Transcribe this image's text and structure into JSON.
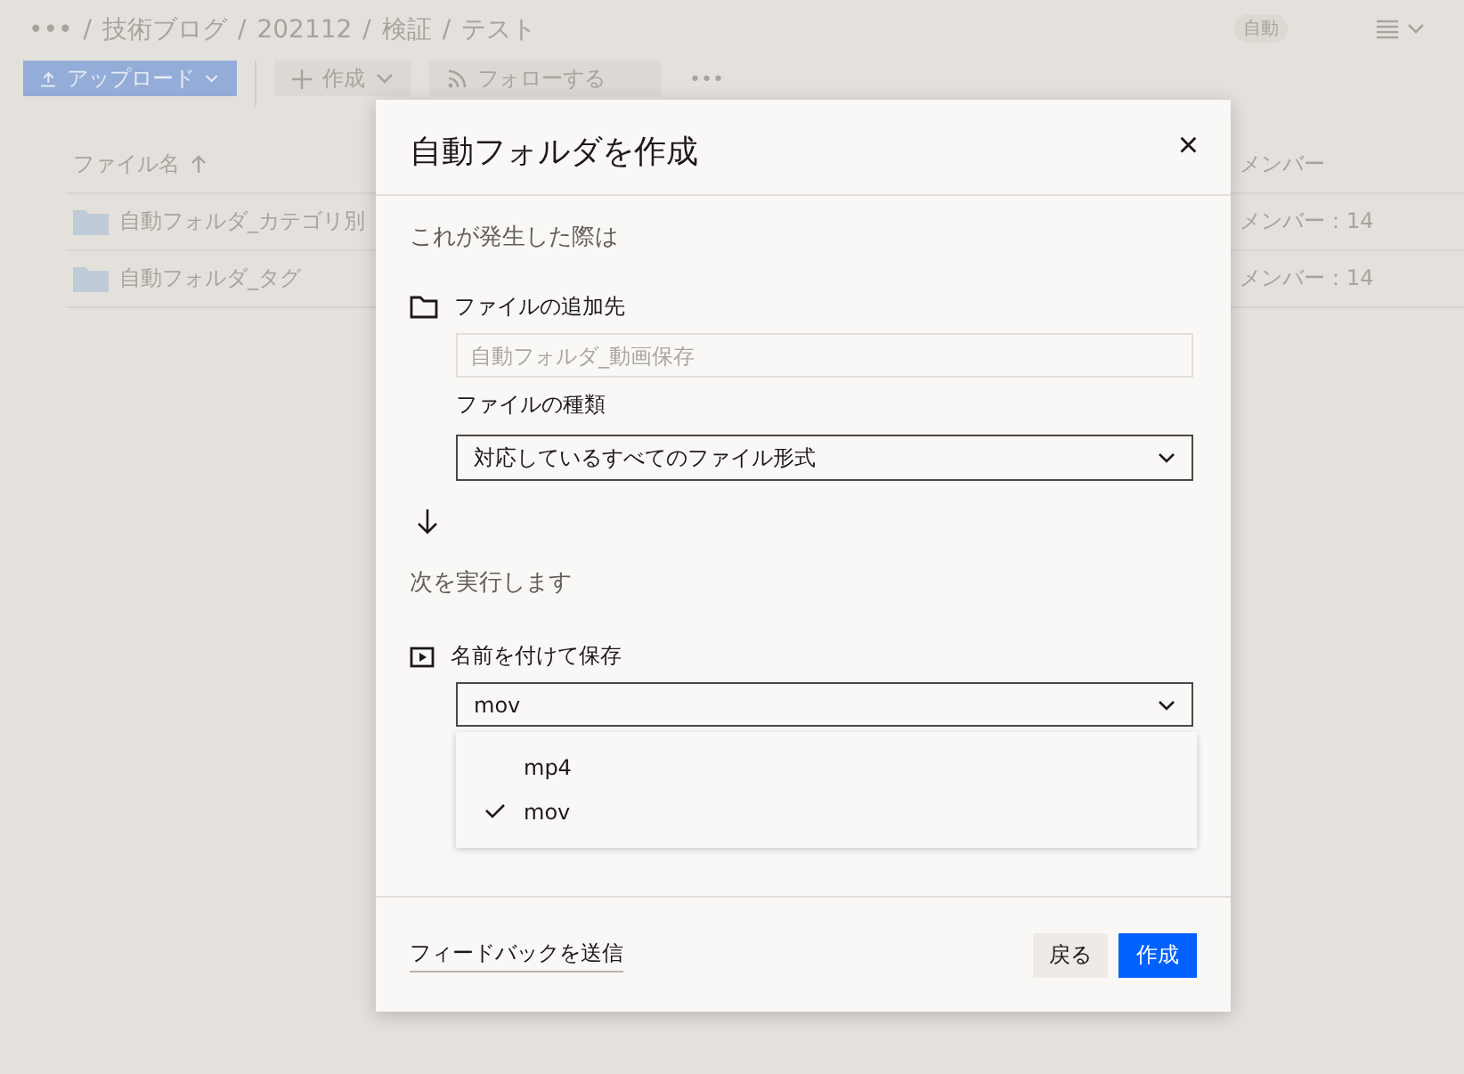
{
  "breadcrumb": {
    "more": "•••",
    "separator": "/",
    "items": [
      "技術ブログ",
      "202112",
      "検証",
      "テスト"
    ]
  },
  "badge": "自動",
  "toolbar": {
    "upload": "アップロード",
    "create": "作成",
    "follow": "フォローする",
    "more": "•••"
  },
  "table": {
    "columns": [
      "ファイル名",
      "メンバー"
    ],
    "rows": [
      {
        "name": "自動フォルダ_カテゴリ別",
        "members": "メンバー：14"
      },
      {
        "name": "自動フォルダ_タグ",
        "members": "メンバー：14"
      }
    ]
  },
  "dialog": {
    "title": "自動フォルダを作成",
    "close": "×",
    "trigger_heading": "これが発生した際は",
    "destination_label": "ファイルの追加先",
    "destination_placeholder": "自動フォルダ_動画保存",
    "type_label": "ファイルの種類",
    "type_value": "対応しているすべてのファイル形式",
    "action_heading": "次を実行します",
    "save_label": "名前を付けて保存",
    "save_value": "mov",
    "options": [
      {
        "label": "mp4",
        "selected": false
      },
      {
        "label": "mov",
        "selected": true
      }
    ],
    "feedback": "フィードバックを送信",
    "back": "戻る",
    "create": "作成"
  }
}
